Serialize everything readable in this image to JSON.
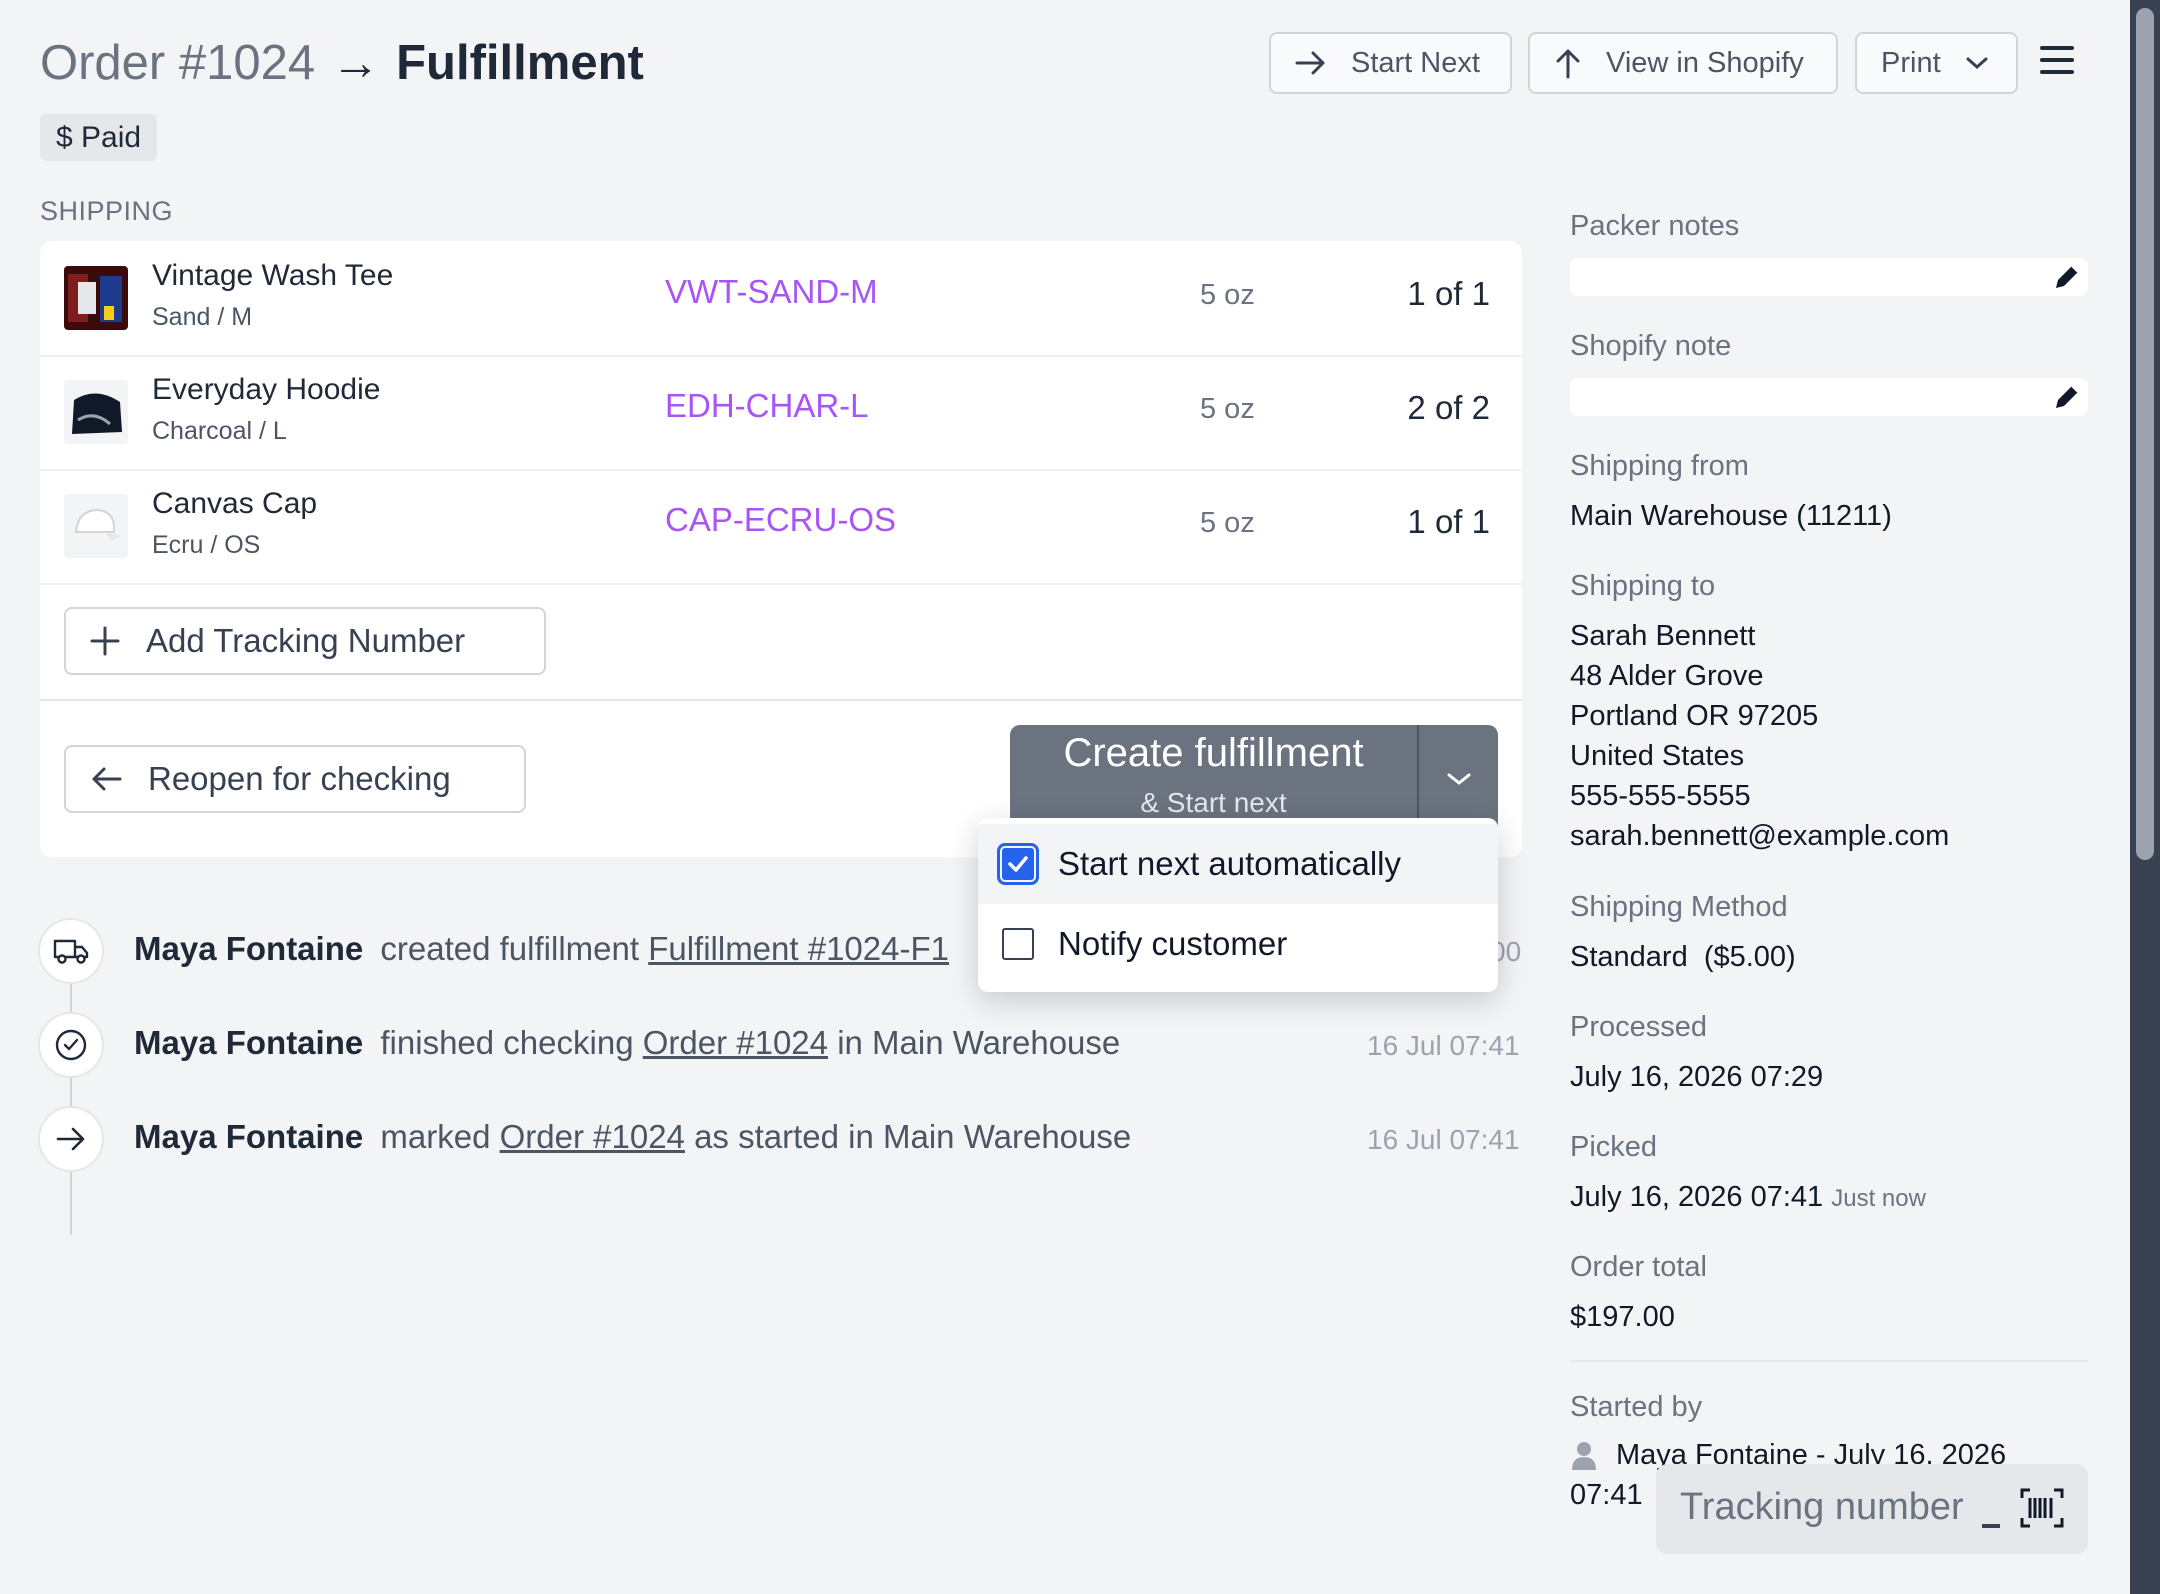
{
  "header": {
    "order": "Order #1024",
    "arrow": "→",
    "page": "Fulfillment",
    "paid_badge": "$ Paid",
    "start_next": "Start Next",
    "view_shopify": "View in Shopify",
    "print": "Print"
  },
  "section_label": "SHIPPING",
  "items": [
    {
      "name": "Vintage Wash Tee",
      "variant": "Sand / M",
      "sku": "VWT-SAND-M",
      "weight": "5 oz",
      "qty": "1 of 1"
    },
    {
      "name": "Everyday Hoodie",
      "variant": "Charcoal / L",
      "sku": "EDH-CHAR-L",
      "weight": "5 oz",
      "qty": "2 of 2"
    },
    {
      "name": "Canvas Cap",
      "variant": "Ecru / OS",
      "sku": "CAP-ECRU-OS",
      "weight": "5 oz",
      "qty": "1 of 1"
    }
  ],
  "actions": {
    "add_tracking": "Add Tracking Number",
    "reopen": "Reopen for checking",
    "create_main": "Create fulfillment",
    "create_sub": "& Start next"
  },
  "dropdown": {
    "option1": "Start next automatically",
    "option1_checked": true,
    "option2": "Notify customer",
    "option2_checked": false
  },
  "timeline": [
    {
      "user": "Maya Fontaine",
      "pre": "created fulfillment",
      "link": "Fulfillment #1024-F1",
      "post": "",
      "time": "00"
    },
    {
      "user": "Maya Fontaine",
      "pre": "finished checking",
      "link": "Order #1024",
      "post": "in Main Warehouse",
      "time": "16 Jul 07:41"
    },
    {
      "user": "Maya Fontaine",
      "pre": "marked",
      "link": "Order #1024",
      "post": "as started in Main Warehouse",
      "time": "16 Jul 07:41"
    }
  ],
  "sidebar": {
    "packer_notes_label": "Packer notes",
    "shopify_note_label": "Shopify note",
    "shipping_from_label": "Shipping from",
    "shipping_from": "Main Warehouse (11211)",
    "shipping_to_label": "Shipping to",
    "to_name": "Sarah Bennett",
    "to_street": "48 Alder Grove",
    "to_city": "Portland OR 97205",
    "to_country": "United States",
    "to_phone": "555-555-5555",
    "to_email": "sarah.bennett@example.com",
    "method_label": "Shipping Method",
    "method": "Standard  ($5.00)",
    "processed_label": "Processed",
    "processed": "July 16, 2026 07:29",
    "picked_label": "Picked",
    "picked": "July 16, 2026 07:41",
    "picked_rel": "Just now",
    "total_label": "Order total",
    "total": "$197.00",
    "started_label": "Started by",
    "started_by": "Maya Fontaine - July 16, 2026",
    "started_time": "07:41"
  },
  "tracking_input": {
    "placeholder": "Tracking number"
  },
  "colors": {
    "sku": "#a855f7",
    "create_btn": "#6b7280",
    "checkbox": "#2563eb"
  }
}
